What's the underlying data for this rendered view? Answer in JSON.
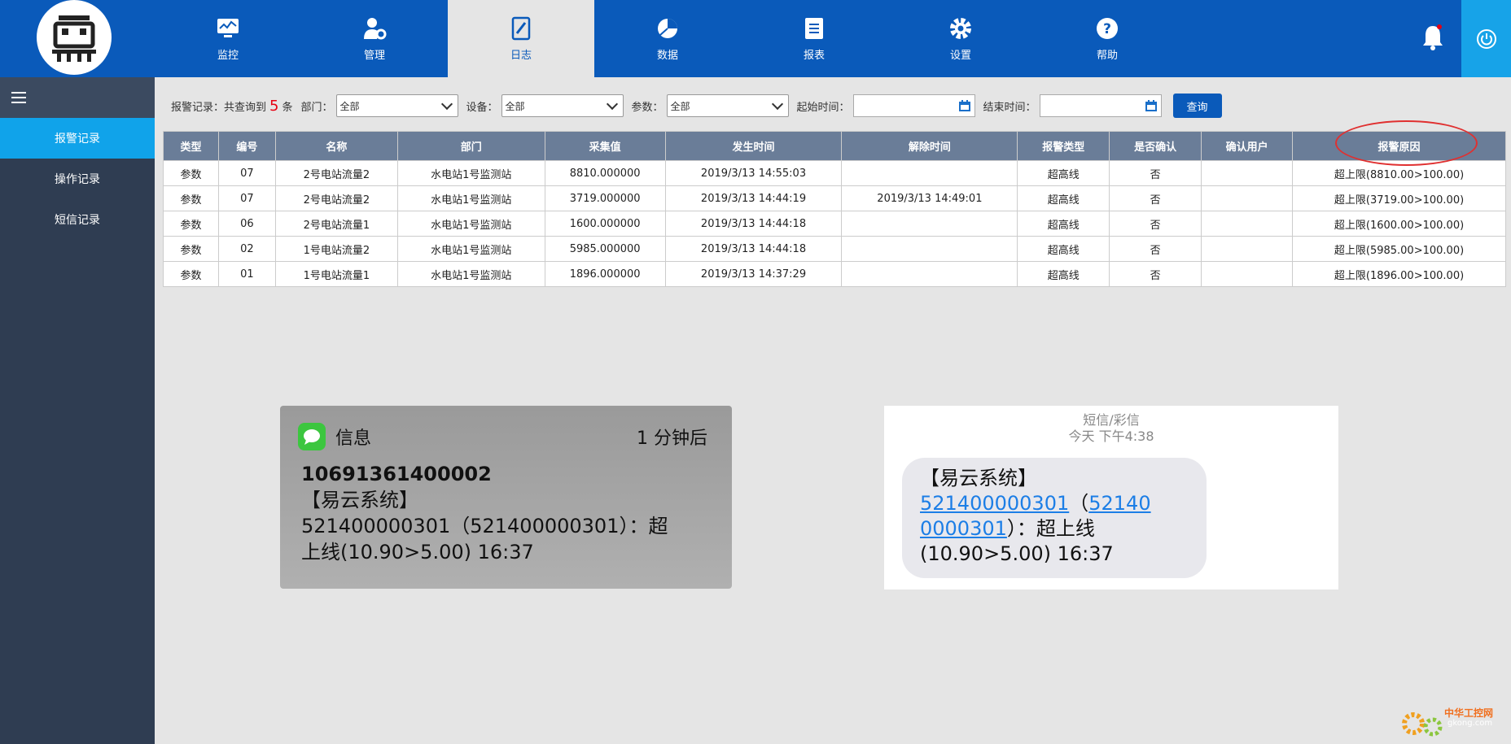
{
  "nav": {
    "items": [
      {
        "label": "监控",
        "icon": "monitor-icon"
      },
      {
        "label": "管理",
        "icon": "user-gear-icon"
      },
      {
        "label": "日志",
        "icon": "log-book-icon"
      },
      {
        "label": "数据",
        "icon": "pie-chart-icon"
      },
      {
        "label": "报表",
        "icon": "report-icon"
      },
      {
        "label": "设置",
        "icon": "gear-icon"
      },
      {
        "label": "帮助",
        "icon": "help-icon"
      }
    ],
    "active_index": 2
  },
  "sidebar": {
    "items": [
      {
        "label": "报警记录"
      },
      {
        "label": "操作记录"
      },
      {
        "label": "短信记录"
      }
    ]
  },
  "filter": {
    "summary_prefix": "报警记录：共查询到",
    "count": "5",
    "summary_suffix": "条",
    "dept_label": "部门：",
    "dept_value": "全部",
    "device_label": "设备：",
    "device_value": "全部",
    "param_label": "参数：",
    "param_value": "全部",
    "start_label": "起始时间：",
    "end_label": "结束时间：",
    "query_label": "查询"
  },
  "table": {
    "headers": [
      "类型",
      "编号",
      "名称",
      "部门",
      "采集值",
      "发生时间",
      "解除时间",
      "报警类型",
      "是否确认",
      "确认用户",
      "报警原因"
    ],
    "rows": [
      [
        "参数",
        "07",
        "2号电站流量2",
        "水电站1号监测站",
        "8810.000000",
        "2019/3/13 14:55:03",
        "",
        "超高线",
        "否",
        "",
        "超上限(8810.00>100.00)"
      ],
      [
        "参数",
        "07",
        "2号电站流量2",
        "水电站1号监测站",
        "3719.000000",
        "2019/3/13 14:44:19",
        "2019/3/13 14:49:01",
        "超高线",
        "否",
        "",
        "超上限(3719.00>100.00)"
      ],
      [
        "参数",
        "06",
        "2号电站流量1",
        "水电站1号监测站",
        "1600.000000",
        "2019/3/13 14:44:18",
        "",
        "超高线",
        "否",
        "",
        "超上限(1600.00>100.00)"
      ],
      [
        "参数",
        "02",
        "1号电站流量2",
        "水电站1号监测站",
        "5985.000000",
        "2019/3/13 14:44:18",
        "",
        "超高线",
        "否",
        "",
        "超上限(5985.00>100.00)"
      ],
      [
        "参数",
        "01",
        "1号电站流量1",
        "水电站1号监测站",
        "1896.000000",
        "2019/3/13 14:37:29",
        "",
        "超高线",
        "否",
        "",
        "超上限(1896.00>100.00)"
      ]
    ]
  },
  "sms1": {
    "app": "信息",
    "time": "1 分钟后",
    "sender": "10691361400002",
    "line1": "【易云系统】",
    "line2": "521400000301（521400000301）：超",
    "line3": "上线(10.90>5.00) 16:37"
  },
  "sms2": {
    "header": "短信/彩信",
    "subheader": "今天 下午4:38",
    "line1": "【易云系统】",
    "link1": "521400000301",
    "paren_open": "（",
    "link2a": "52140",
    "link2b": "0000301",
    "line2_rest": "）：超上线",
    "line3": "(10.90>5.00) 16:37"
  },
  "watermark": {
    "text1": "中华工控网",
    "text2": "gkong.com"
  },
  "colors": {
    "nav_bg": "#0a5aba",
    "sidebar_bg": "#2f3d52",
    "active_side": "#10a3ea",
    "table_header": "#6a7d98",
    "highlight": "#e60012"
  }
}
